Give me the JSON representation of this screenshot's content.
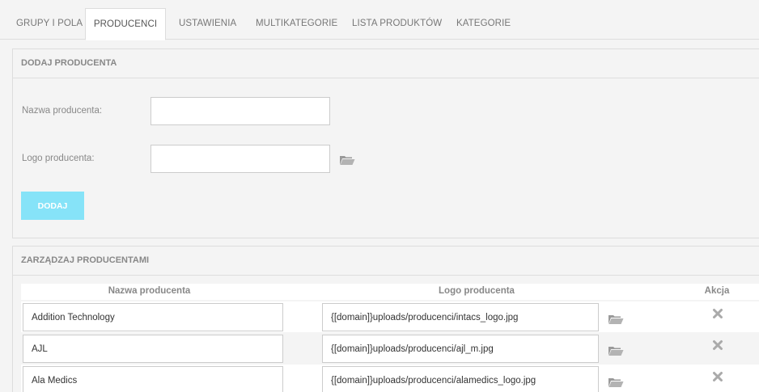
{
  "tabs": [
    {
      "label": "GRUPY I POLA",
      "active": false
    },
    {
      "label": "PRODUCENCI",
      "active": true
    },
    {
      "label": "USTAWIENIA",
      "active": false
    },
    {
      "label": "MULTIKATEGORIE",
      "active": false
    },
    {
      "label": "LISTA PRODUKTÓW",
      "active": false
    },
    {
      "label": "KATEGORIE",
      "active": false
    }
  ],
  "add_panel": {
    "title": "DODAJ PRODUCENTA",
    "name_label": "Nazwa producenta:",
    "name_value": "",
    "logo_label": "Logo producenta:",
    "logo_value": "",
    "logo_icon": "folder-open-icon",
    "submit_label": "DODAJ",
    "submit_color": "#86e3f8"
  },
  "manage_panel": {
    "title": "ZARZĄDZAJ PRODUCENTAMI",
    "columns": [
      "Nazwa producenta",
      "Logo producenta",
      "Akcja"
    ],
    "rows": [
      {
        "name": "Addition Technology",
        "logo": "{[domain]}uploads/producenci/intacs_logo.jpg"
      },
      {
        "name": "AJL",
        "logo": "{[domain]}uploads/producenci/ajl_m.jpg"
      },
      {
        "name": "Ala Medics",
        "logo": "{[domain]}uploads/producenci/alamedics_logo.jpg"
      }
    ],
    "delete_icon": "close-icon"
  }
}
